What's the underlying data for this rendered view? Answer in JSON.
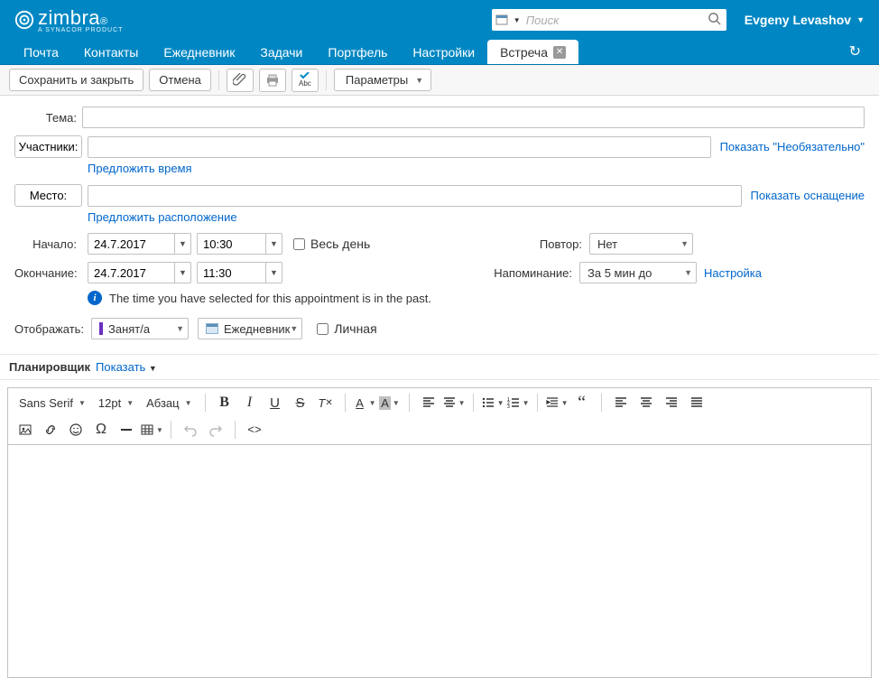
{
  "brand": {
    "name": "zimbra",
    "sub": "A SYNACOR PRODUCT"
  },
  "search": {
    "placeholder": "Поиск"
  },
  "user": {
    "name": "Evgeny Levashov"
  },
  "tabs": {
    "items": [
      "Почта",
      "Контакты",
      "Ежедневник",
      "Задачи",
      "Портфель",
      "Настройки"
    ],
    "active": "Встреча"
  },
  "toolbar": {
    "save_close": "Сохранить и закрыть",
    "cancel": "Отмена",
    "options": "Параметры"
  },
  "form": {
    "subject_label": "Тема:",
    "attendees_label": "Участники:",
    "show_optional": "Показать \"Необязательно\"",
    "suggest_time": "Предложить время",
    "location_label": "Место:",
    "show_equipment": "Показать оснащение",
    "suggest_location": "Предложить расположение",
    "start_label": "Начало:",
    "end_label": "Окончание:",
    "start_date": "24.7.2017",
    "start_time": "10:30",
    "end_date": "24.7.2017",
    "end_time": "11:30",
    "all_day": "Весь день",
    "repeat_label": "Повтор:",
    "repeat_value": "Нет",
    "reminder_label": "Напоминание:",
    "reminder_value": "За 5  мин до",
    "reminder_configure": "Настройка",
    "past_warning": "The time you have selected for this appointment is in the past.",
    "display_label": "Отображать:",
    "show_as": "Занят/а",
    "calendar": "Ежедневник",
    "private": "Личная"
  },
  "scheduler": {
    "title": "Планировщик",
    "toggle": "Показать"
  },
  "rte": {
    "font": "Sans Serif",
    "size": "12pt",
    "para": "Абзац"
  }
}
